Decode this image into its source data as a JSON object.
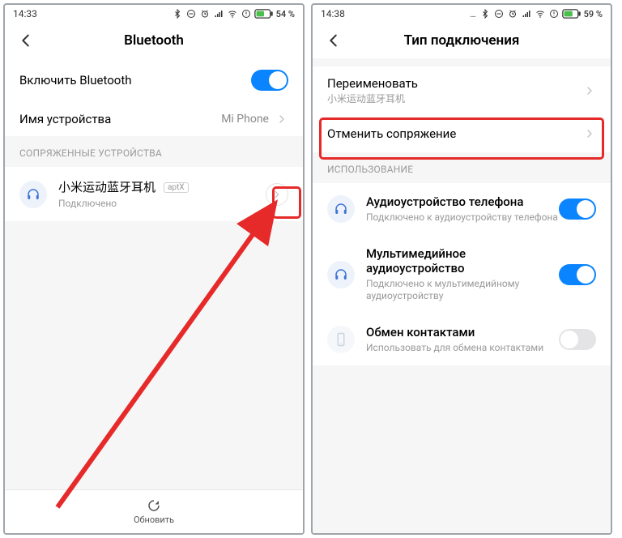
{
  "left": {
    "status": {
      "time": "14:33",
      "battery": "54 %"
    },
    "header": {
      "title": "Bluetooth"
    },
    "bt_toggle": {
      "label": "Включить Bluetooth",
      "on": true
    },
    "device_name_row": {
      "label": "Имя устройства",
      "value": "Mi Phone"
    },
    "section_paired": "СОПРЯЖЕННЫЕ УСТРОЙСТВА",
    "device": {
      "name": "小米运动蓝牙耳机",
      "badge": "aptX",
      "status": "Подключено"
    },
    "footer": {
      "refresh": "Обновить"
    }
  },
  "right": {
    "status": {
      "time": "14:38",
      "battery": "59 %"
    },
    "header": {
      "title": "Тип подключения"
    },
    "rename": {
      "label": "Переименовать",
      "sub": "小米运动蓝牙耳机"
    },
    "unpair": {
      "label": "Отменить сопряжение"
    },
    "section_usage": "ИСПОЛЬЗОВАНИЕ",
    "usage": {
      "phone_audio": {
        "label": "Аудиоустройство телефона",
        "sub": "Подключено к аудиоустройству телефона",
        "on": true
      },
      "media_audio": {
        "label": "Мультимедийное аудиоустройство",
        "sub": "Подключено к мультимедийному аудиоустройству",
        "on": true
      },
      "contacts": {
        "label": "Обмен контактами",
        "sub": "Использовать для обмена контактами",
        "on": false
      }
    }
  }
}
